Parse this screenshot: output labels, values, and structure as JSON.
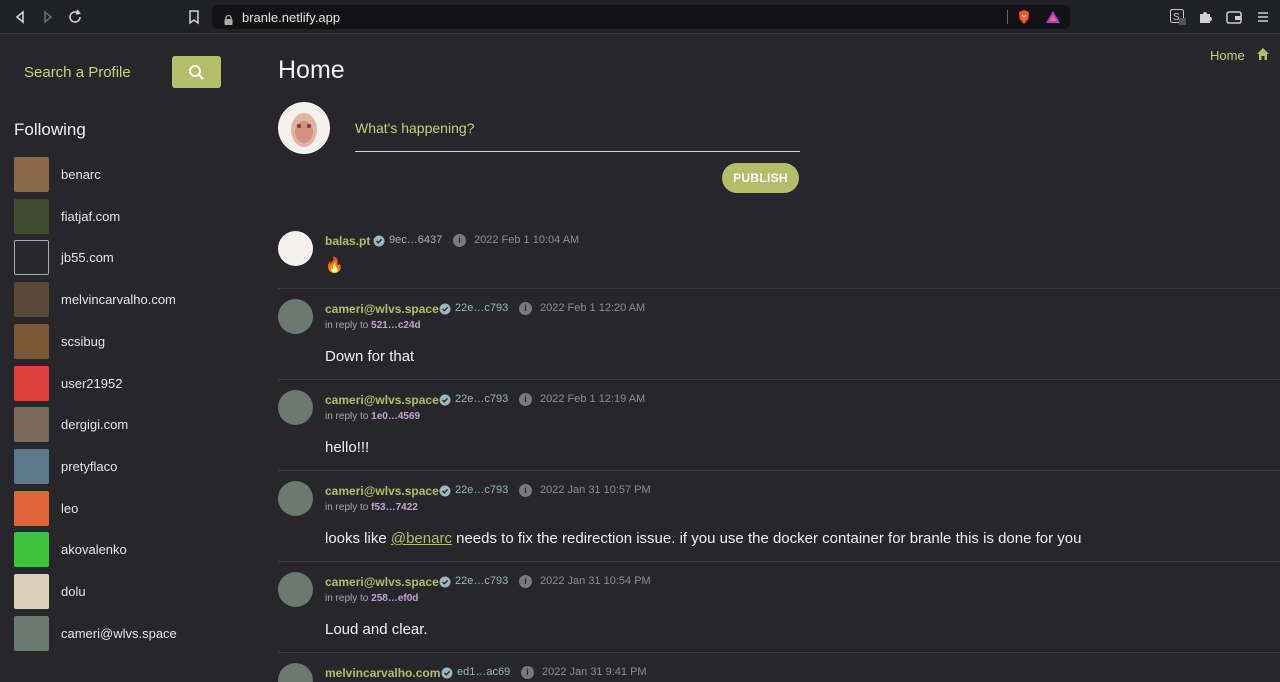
{
  "browser": {
    "url": "branle.netlify.app",
    "tab_badge": "1"
  },
  "sidebar": {
    "search_label": "Search a Profile",
    "following_title": "Following",
    "following": [
      {
        "name": "benarc",
        "color": "#8a6a4a"
      },
      {
        "name": "fiatjaf.com",
        "color": "#3f4a2e"
      },
      {
        "name": "jb55.com",
        "color": "#27272b"
      },
      {
        "name": "melvincarvalho.com",
        "color": "#5a4838"
      },
      {
        "name": "scsibug",
        "color": "#7a5a36"
      },
      {
        "name": "user21952",
        "color": "#e04040"
      },
      {
        "name": "dergigi.com",
        "color": "#7a6a5e"
      },
      {
        "name": "pretyflaco",
        "color": "#5a7a8a"
      },
      {
        "name": "leo",
        "color": "#e0663a"
      },
      {
        "name": "akovalenko",
        "color": "#3cc23c"
      },
      {
        "name": "dolu",
        "color": "#d8d0b8"
      },
      {
        "name": "cameri@wlvs.space",
        "color": "#6a7a70"
      }
    ]
  },
  "main": {
    "title": "Home",
    "home_link": "Home",
    "composer_placeholder": "What's happening?",
    "publish_label": "PUBLISH"
  },
  "feed": [
    {
      "author": "balas.pt",
      "pubkey": "9ec…6437",
      "time": "2022 Feb 1 10:04 AM",
      "reply_label": "",
      "reply_to": "",
      "content": "🔥"
    },
    {
      "author": "cameri@wlvs.space",
      "pubkey": "22e…c793",
      "time": "2022 Feb 1 12:20 AM",
      "reply_label": "in reply to",
      "reply_to": "521…c24d",
      "content": "Down for that"
    },
    {
      "author": "cameri@wlvs.space",
      "pubkey": "22e…c793",
      "time": "2022 Feb 1 12:19 AM",
      "reply_label": "in reply to",
      "reply_to": "1e0…4569",
      "content": "hello!!!"
    },
    {
      "author": "cameri@wlvs.space",
      "pubkey": "22e…c793",
      "time": "2022 Jan 31 10:57 PM",
      "reply_label": "in reply to",
      "reply_to": "f53…7422",
      "content_before": "looks like ",
      "mention": "@benarc",
      "content_after": " needs to fix the redirection issue. if you use the docker container for branle this is done for you"
    },
    {
      "author": "cameri@wlvs.space",
      "pubkey": "22e…c793",
      "time": "2022 Jan 31 10:54 PM",
      "reply_label": "in reply to",
      "reply_to": "258…ef0d",
      "content": "Loud and clear."
    },
    {
      "author": "melvincarvalho.com",
      "pubkey": "ed1…ac69",
      "time": "2022 Jan 31 9:41 PM",
      "reply_label": "",
      "reply_to": "",
      "content": ""
    }
  ],
  "colors": {
    "accent": "#b4bd6a",
    "background": "#27272b"
  }
}
